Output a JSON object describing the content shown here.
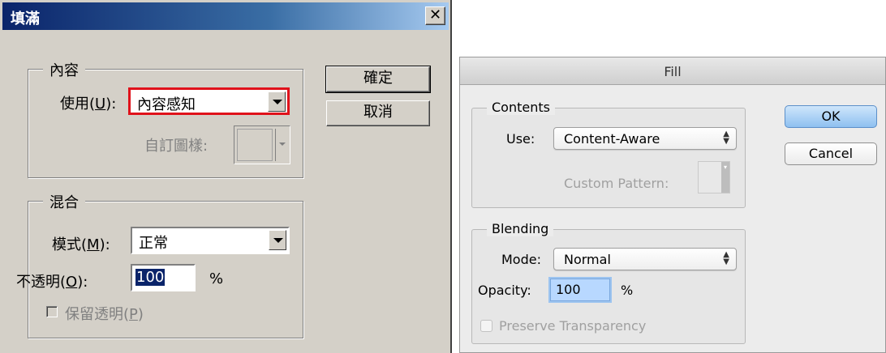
{
  "win": {
    "title": "填滿",
    "close_glyph": "✕",
    "contents": {
      "group_label": "內容",
      "use_label_prefix": "使用(",
      "use_label_key": "U",
      "use_label_suffix": "):",
      "use_value": "內容感知",
      "custom_pattern_label": "自訂圖樣:"
    },
    "blending": {
      "group_label": "混合",
      "mode_label_prefix": "模式(",
      "mode_label_key": "M",
      "mode_label_suffix": "):",
      "mode_value": "正常",
      "opacity_label_prefix": "不透明(",
      "opacity_label_key": "O",
      "opacity_label_suffix": "):",
      "opacity_value": "100",
      "opacity_unit": "%",
      "preserve_prefix": "保留透明(",
      "preserve_key": "P",
      "preserve_suffix": ")"
    },
    "buttons": {
      "ok": "確定",
      "cancel": "取消"
    }
  },
  "mac": {
    "title": "Fill",
    "contents": {
      "group_label": "Contents",
      "use_label": "Use:",
      "use_value": "Content-Aware",
      "custom_pattern_label": "Custom Pattern:"
    },
    "blending": {
      "group_label": "Blending",
      "mode_label": "Mode:",
      "mode_value": "Normal",
      "opacity_label": "Opacity:",
      "opacity_value": "100",
      "opacity_unit": "%",
      "preserve_label": "Preserve Transparency"
    },
    "buttons": {
      "ok": "OK",
      "cancel": "Cancel"
    },
    "popup_arrows": "▲\n▼"
  },
  "colors": {
    "win_highlight": "#e0121b",
    "win_title_bar": "#0a246a",
    "mac_default_button": "#8ec0f0"
  }
}
